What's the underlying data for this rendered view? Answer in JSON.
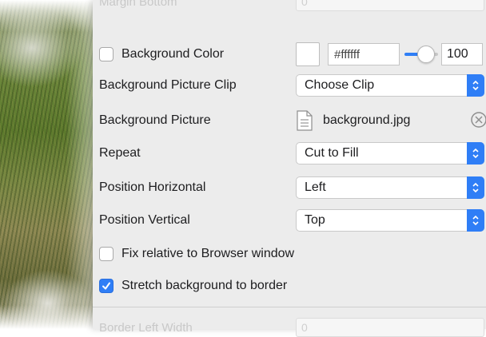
{
  "ghost_top": {
    "label": "Margin Bottom",
    "value": "0"
  },
  "ghost_bottom": {
    "label": "Border Left Width",
    "value": "0"
  },
  "background_color": {
    "label": "Background Color",
    "checked": false,
    "swatch_color": "#ffffff",
    "hex": "#ffffff",
    "opacity": "100",
    "opacity_fraction": 1.0
  },
  "picture_clip": {
    "label": "Background Picture Clip",
    "value": "Choose Clip"
  },
  "picture": {
    "label": "Background Picture",
    "file": "background.jpg",
    "file_icon": "document-icon",
    "remove_icon": "clear-x-icon"
  },
  "repeat": {
    "label": "Repeat",
    "value": "Cut to Fill"
  },
  "position_horizontal": {
    "label": "Position Horizontal",
    "value": "Left"
  },
  "position_vertical": {
    "label": "Position Vertical",
    "value": "Top"
  },
  "fix_relative": {
    "label": "Fix relative to Browser window",
    "checked": false
  },
  "stretch": {
    "label": "Stretch background to border",
    "checked": true
  },
  "colors": {
    "accent": "#2f7ef6",
    "panel": "#ececec",
    "text": "#1d1d1f"
  }
}
